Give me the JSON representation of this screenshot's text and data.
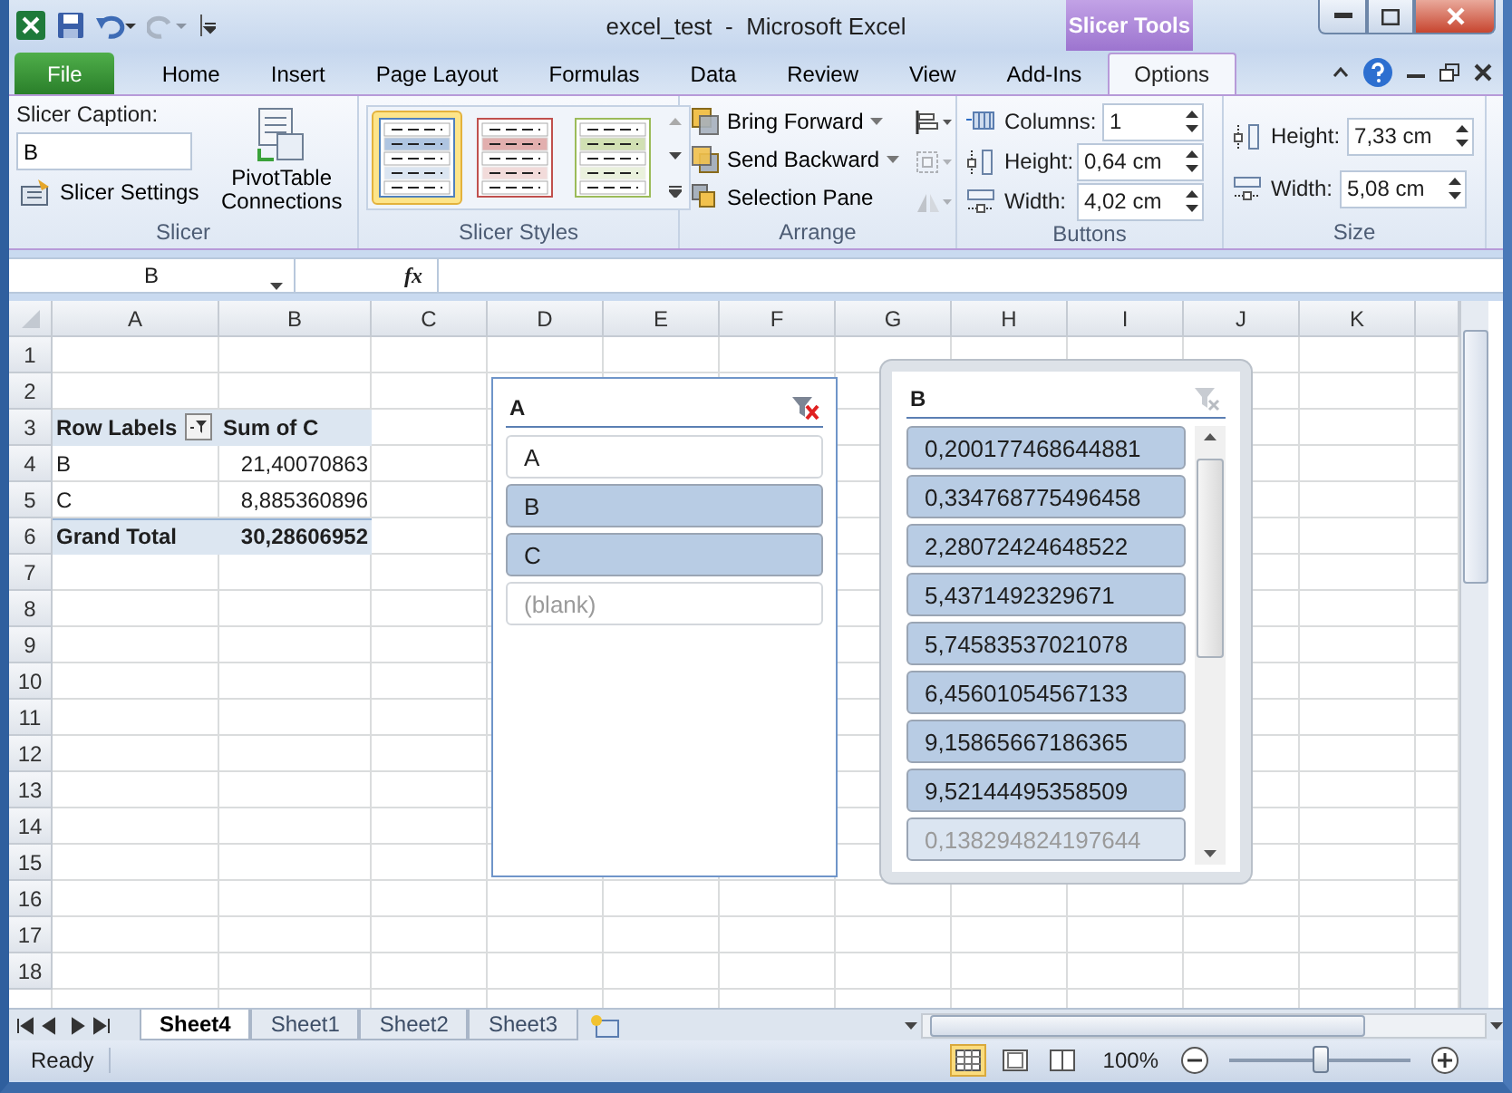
{
  "title_bar": {
    "title": "excel_test  -  Microsoft Excel",
    "context_tab": "Slicer Tools"
  },
  "ribbon_tabs": [
    {
      "label": "File",
      "kind": "file",
      "selected": false
    },
    {
      "label": "Home",
      "kind": "tab",
      "selected": false
    },
    {
      "label": "Insert",
      "kind": "tab",
      "selected": false
    },
    {
      "label": "Page Layout",
      "kind": "tab",
      "selected": false
    },
    {
      "label": "Formulas",
      "kind": "tab",
      "selected": false
    },
    {
      "label": "Data",
      "kind": "tab",
      "selected": false
    },
    {
      "label": "Review",
      "kind": "tab",
      "selected": false
    },
    {
      "label": "View",
      "kind": "tab",
      "selected": false
    },
    {
      "label": "Add-Ins",
      "kind": "tab",
      "selected": false
    },
    {
      "label": "Options",
      "kind": "context",
      "selected": true
    }
  ],
  "ribbon": {
    "slicer": {
      "caption_label": "Slicer Caption:",
      "caption_value": "B",
      "settings": "Slicer Settings",
      "connections": "PivotTable Connections",
      "label": "Slicer"
    },
    "styles": {
      "label": "Slicer Styles",
      "items": [
        {
          "color": "#4f81bd",
          "selected": true
        },
        {
          "color": "#c0504d",
          "selected": false
        },
        {
          "color": "#9bbb59",
          "selected": false
        }
      ]
    },
    "arrange": {
      "label": "Arrange",
      "buttons": [
        {
          "label": "Bring Forward",
          "dropdown": true
        },
        {
          "label": "Send Backward",
          "dropdown": true
        },
        {
          "label": "Selection Pane",
          "dropdown": false
        }
      ],
      "icon_buttons": [
        {
          "disabled": false
        },
        {
          "disabled": true
        },
        {
          "disabled": true
        }
      ]
    },
    "buttons": {
      "label": "Buttons",
      "fields": [
        {
          "label": "Columns:",
          "value": "1"
        },
        {
          "label": "Height:",
          "value": "0,64 cm"
        },
        {
          "label": "Width:",
          "value": "4,02 cm"
        }
      ]
    },
    "size": {
      "label": "Size",
      "fields": [
        {
          "label": "Height:",
          "value": "7,33 cm"
        },
        {
          "label": "Width:",
          "value": "5,08 cm"
        }
      ]
    }
  },
  "formula_bar": {
    "name_box": "B",
    "function_label": "fx"
  },
  "sheet": {
    "columns": [
      "A",
      "B",
      "C",
      "D",
      "E",
      "F",
      "G",
      "H",
      "I",
      "J",
      "K"
    ],
    "rows": [
      "1",
      "2",
      "3",
      "4",
      "5",
      "6",
      "7",
      "8",
      "9",
      "10",
      "11",
      "12",
      "13",
      "14",
      "15",
      "16",
      "17",
      "18"
    ],
    "pivot": {
      "header": [
        "Row Labels",
        "Sum of C"
      ],
      "rows": [
        {
          "label": "B",
          "value": "21,40070863"
        },
        {
          "label": "C",
          "value": "8,885360896"
        }
      ],
      "total": {
        "label": "Grand Total",
        "value": "30,28606952"
      }
    }
  },
  "slicers": [
    {
      "title": "A",
      "filtered": true,
      "active": false,
      "items": [
        {
          "label": "A",
          "selected": false,
          "has_data": true
        },
        {
          "label": "B",
          "selected": true,
          "has_data": true
        },
        {
          "label": "C",
          "selected": true,
          "has_data": true
        },
        {
          "label": "(blank)",
          "selected": false,
          "has_data": false
        }
      ]
    },
    {
      "title": "B",
      "filtered": false,
      "active": true,
      "items": [
        {
          "label": "0,200177468644881",
          "selected": true,
          "has_data": true
        },
        {
          "label": "0,334768775496458",
          "selected": true,
          "has_data": true
        },
        {
          "label": "2,28072424648522",
          "selected": true,
          "has_data": true
        },
        {
          "label": "5,4371492329671",
          "selected": true,
          "has_data": true
        },
        {
          "label": "5,74583537021078",
          "selected": true,
          "has_data": true
        },
        {
          "label": "6,45601054567133",
          "selected": true,
          "has_data": true
        },
        {
          "label": "9,15865667186365",
          "selected": true,
          "has_data": true
        },
        {
          "label": "9,52144495358509",
          "selected": true,
          "has_data": true
        },
        {
          "label": "0,138294824197644",
          "selected": true,
          "has_data": false
        }
      ]
    }
  ],
  "sheet_tabs": [
    {
      "label": "Sheet4",
      "selected": true
    },
    {
      "label": "Sheet1",
      "selected": false
    },
    {
      "label": "Sheet2",
      "selected": false
    },
    {
      "label": "Sheet3",
      "selected": false
    }
  ],
  "status_bar": {
    "status": "Ready",
    "views": [
      {
        "selected": true
      },
      {
        "selected": false
      },
      {
        "selected": false
      }
    ],
    "zoom": "100%",
    "zoom_slider": {
      "level": 0.5
    }
  }
}
